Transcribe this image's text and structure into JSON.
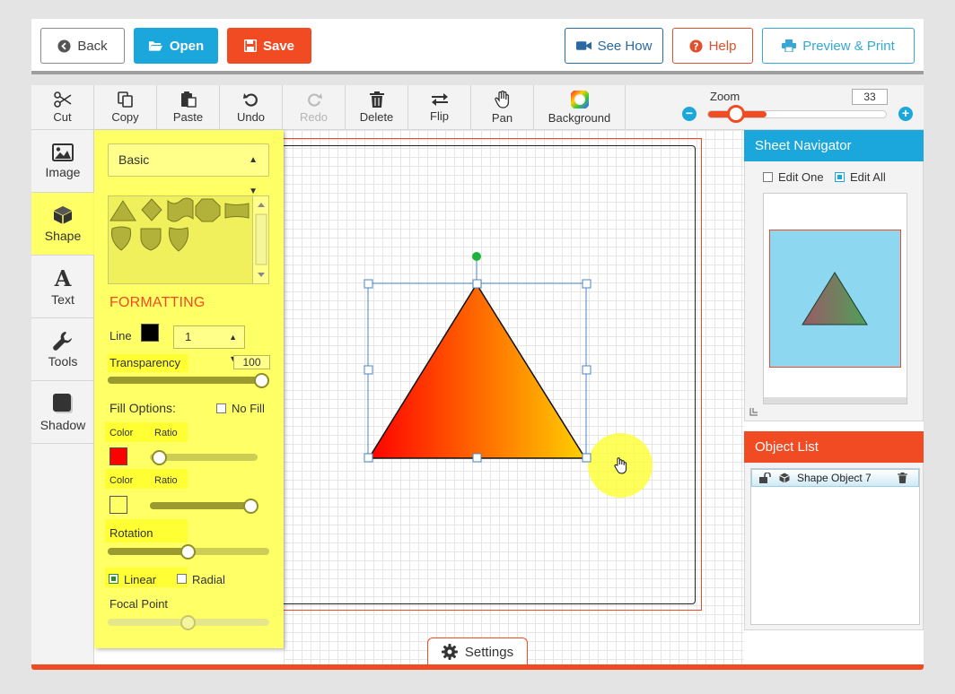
{
  "topbar": {
    "back_label": "Back",
    "open_label": "Open",
    "save_label": "Save",
    "seehow_label": "See How",
    "help_label": "Help",
    "print_label": "Preview & Print"
  },
  "toolbar": {
    "cut": "Cut",
    "copy": "Copy",
    "paste": "Paste",
    "undo": "Undo",
    "redo": "Redo",
    "delete": "Delete",
    "flip": "Flip",
    "pan": "Pan",
    "background": "Background",
    "zoom_label": "Zoom",
    "zoom_value": "33",
    "zoom_fraction": 0.33
  },
  "left_tabs": [
    {
      "label": "Image",
      "icon": "image-icon"
    },
    {
      "label": "Shape",
      "icon": "cube-icon",
      "active": true
    },
    {
      "label": "Text",
      "icon": "text-icon"
    },
    {
      "label": "Tools",
      "icon": "wrench-icon"
    },
    {
      "label": "Shadow",
      "icon": "shadow-icon"
    }
  ],
  "panel": {
    "shape_category": "Basic",
    "formatting_title": "FORMATTING",
    "line_label": "Line",
    "line_color": "#000000",
    "line_width": "1",
    "transparency_label": "Transparency",
    "transparency_value": "100",
    "fill_options_label": "Fill Options:",
    "no_fill_label": "No Fill",
    "color1_label": "Color",
    "ratio1_label": "Ratio",
    "color1": "#ff0000",
    "color2_label": "Color",
    "ratio2_label": "Ratio",
    "color2": "#ffff66",
    "rotation_label": "Rotation",
    "linear_label": "Linear",
    "radial_label": "Radial",
    "focal_point_label": "Focal Point",
    "gradient_type": "linear"
  },
  "canvas": {
    "shape_gradient_start": "#ff0000",
    "shape_gradient_end": "#ffd000"
  },
  "settings_label": "Settings",
  "navigator": {
    "title": "Sheet Navigator",
    "edit_one_label": "Edit One",
    "edit_all_label": "Edit All",
    "edit_mode": "all"
  },
  "object_list": {
    "title": "Object List",
    "items": [
      {
        "label": "Shape Object 7"
      }
    ]
  },
  "colors": {
    "accent_blue": "#1ba7dc",
    "accent_orange": "#f14b23",
    "panel_yellow": "#ffff66"
  }
}
